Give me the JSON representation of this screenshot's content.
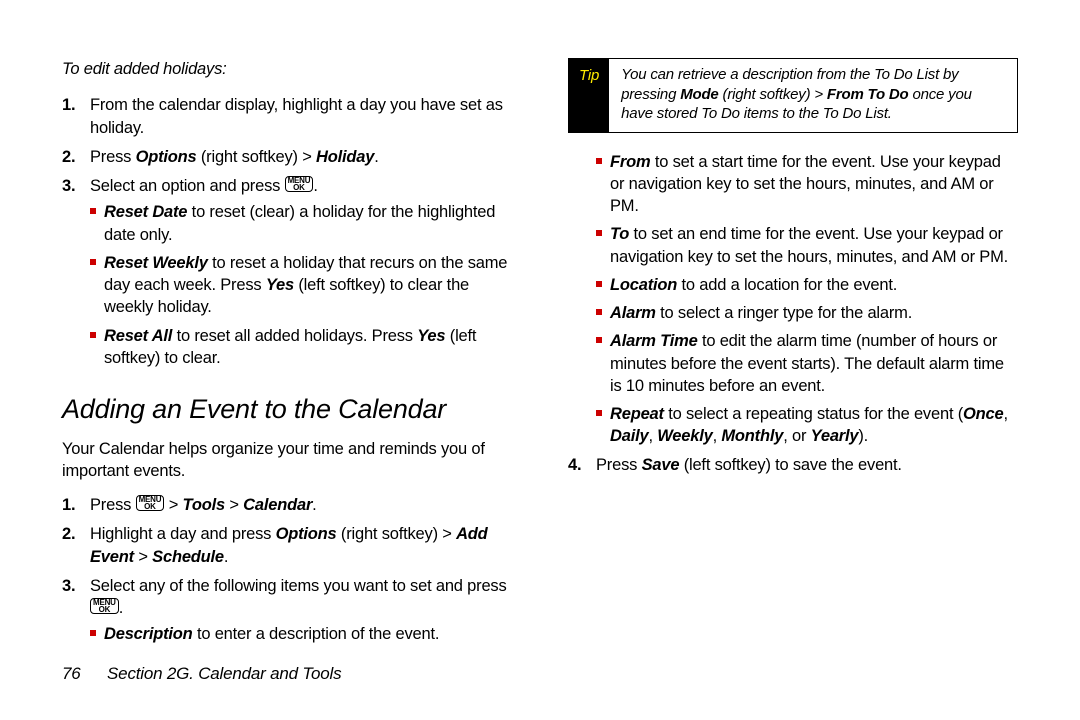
{
  "left": {
    "subhead": "To edit added holidays:",
    "ol1": {
      "n": "1.",
      "t1": "From the calendar display, highlight a day you have set as holiday."
    },
    "ol2": {
      "n": "2.",
      "a": "Press ",
      "b": "Options",
      "c": " (right softkey) > ",
      "d": "Holiday",
      "e": "."
    },
    "ol3": {
      "n": "3.",
      "a": "Select an option and press ",
      "b": "."
    },
    "sub": {
      "rd_b": "Reset Date",
      "rd_t": " to reset (clear) a holiday for the highlighted date only.",
      "rw_b": "Reset Weekly",
      "rw_t1": " to reset a holiday that recurs on the same day each week. Press ",
      "rw_yes": "Yes",
      "rw_t2": " (left softkey) to clear the weekly holiday.",
      "ra_b": "Reset All",
      "ra_t1": " to reset all added holidays. Press ",
      "ra_yes": "Yes",
      "ra_t2": " (left softkey) to clear."
    },
    "h2": "Adding an Event to the Calendar",
    "intro": "Your Calendar helps organize your time and reminds you of important events.",
    "step1": {
      "n": "1.",
      "a": "Press ",
      "b": " > ",
      "c": "Tools",
      "d": " > ",
      "e": "Calendar",
      "f": "."
    },
    "step2": {
      "n": "2.",
      "a": "Highlight a day and press ",
      "b": "Options",
      "c": " (right softkey) > ",
      "d": "Add Event",
      "e": " > ",
      "f": "Schedule",
      "g": "."
    },
    "step3": {
      "n": "3.",
      "a": "Select any of the following items you want to set and press ",
      "b": "."
    },
    "desc_b": "Description",
    "desc_t": " to enter a description of the event."
  },
  "right": {
    "tip": {
      "label": "Tip",
      "a": "You can retrieve a description from the To Do List by pressing ",
      "b": "Mode",
      "c": " (right softkey) > ",
      "d": "From To Do",
      "e": " once you have stored To Do items to the To Do List."
    },
    "from_b": "From",
    "from_t": " to set a start time for the event. Use your keypad or navigation key to set the hours, minutes, and AM or PM.",
    "to_b": "To",
    "to_t": " to set an end time for the event. Use your keypad or navigation key to set the hours, minutes, and AM or PM.",
    "loc_b": "Location",
    "loc_t": " to add a location for the event.",
    "alm_b": "Alarm",
    "alm_t": " to select a ringer type for the alarm.",
    "at_b": "Alarm Time",
    "at_t": " to edit the alarm time (number of hours or minutes before the event starts). The default alarm time is 10 minutes before an event.",
    "rep_b": "Repeat",
    "rep_t1": " to select a repeating status for the event (",
    "rep_o": "Once",
    "rep_c1": ", ",
    "rep_d": "Daily",
    "rep_c2": ", ",
    "rep_w": "Weekly",
    "rep_c3": ", ",
    "rep_m": "Monthly",
    "rep_c4": ", or ",
    "rep_y": "Yearly",
    "rep_t2": ").",
    "step4": {
      "n": "4.",
      "a": "Press ",
      "b": "Save",
      "c": " (left softkey) to save the event."
    }
  },
  "footer": {
    "page": "76",
    "section": "Section 2G. Calendar and Tools"
  },
  "key_glyph": "MENU\nOK"
}
